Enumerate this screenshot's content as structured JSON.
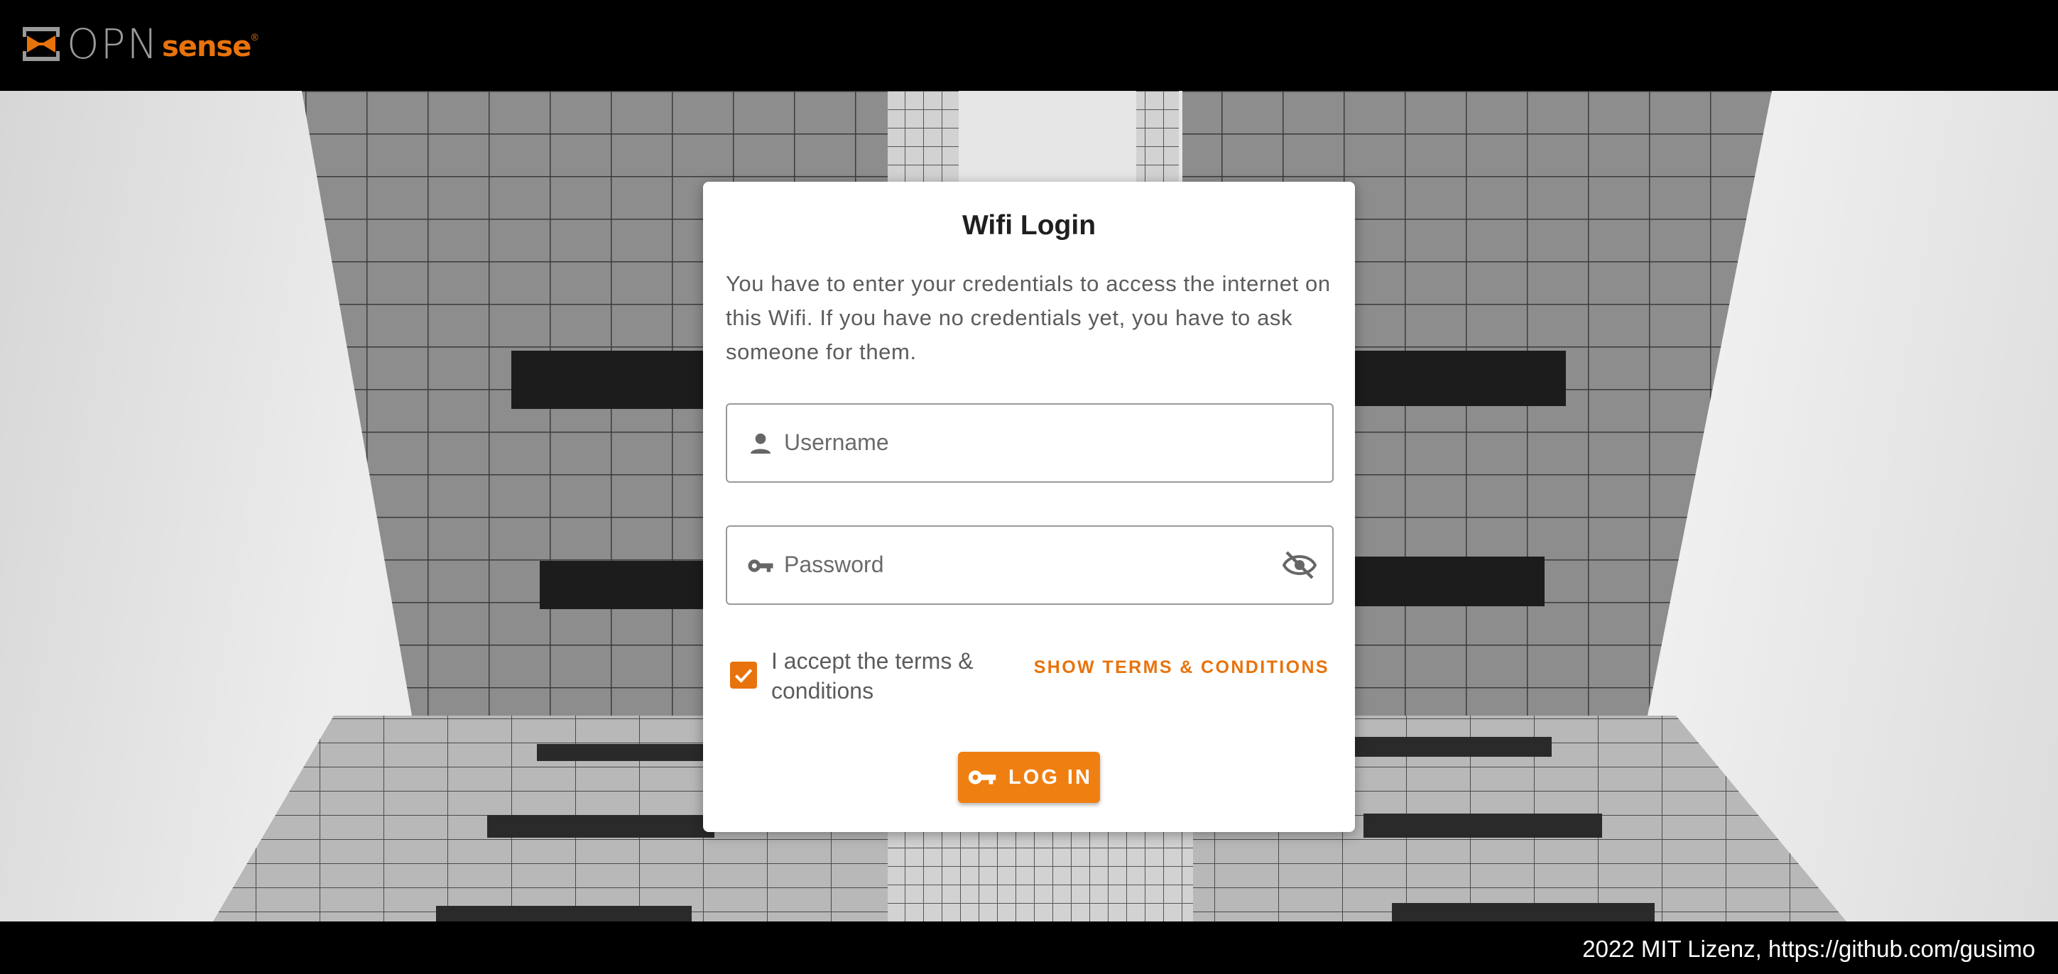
{
  "brand": {
    "opn": "OPN",
    "sense": "sense",
    "reg": "®"
  },
  "card": {
    "title": "Wifi Login",
    "description": "You have to enter your credentials to access the internet on this Wifi. If you have no credentials yet, you have to ask someone for them.",
    "username_placeholder": "Username",
    "password_placeholder": "Password",
    "accept_label": "I accept the terms & conditions",
    "accept_checked": true,
    "terms_link": "SHOW TERMS & CONDITIONS",
    "login_label": "LOG IN"
  },
  "footer": {
    "text": "2022 MIT Lizenz, https://github.com/gusimo"
  },
  "colors": {
    "accent": "#f07f12",
    "topbar": "#000000",
    "card": "#ffffff"
  },
  "icons": {
    "logo": "opnsense-logo-icon",
    "username": "person-icon",
    "password": "key-icon",
    "toggle_visibility": "eye-off-icon",
    "checkbox": "checkmark-icon",
    "login": "key-icon"
  }
}
